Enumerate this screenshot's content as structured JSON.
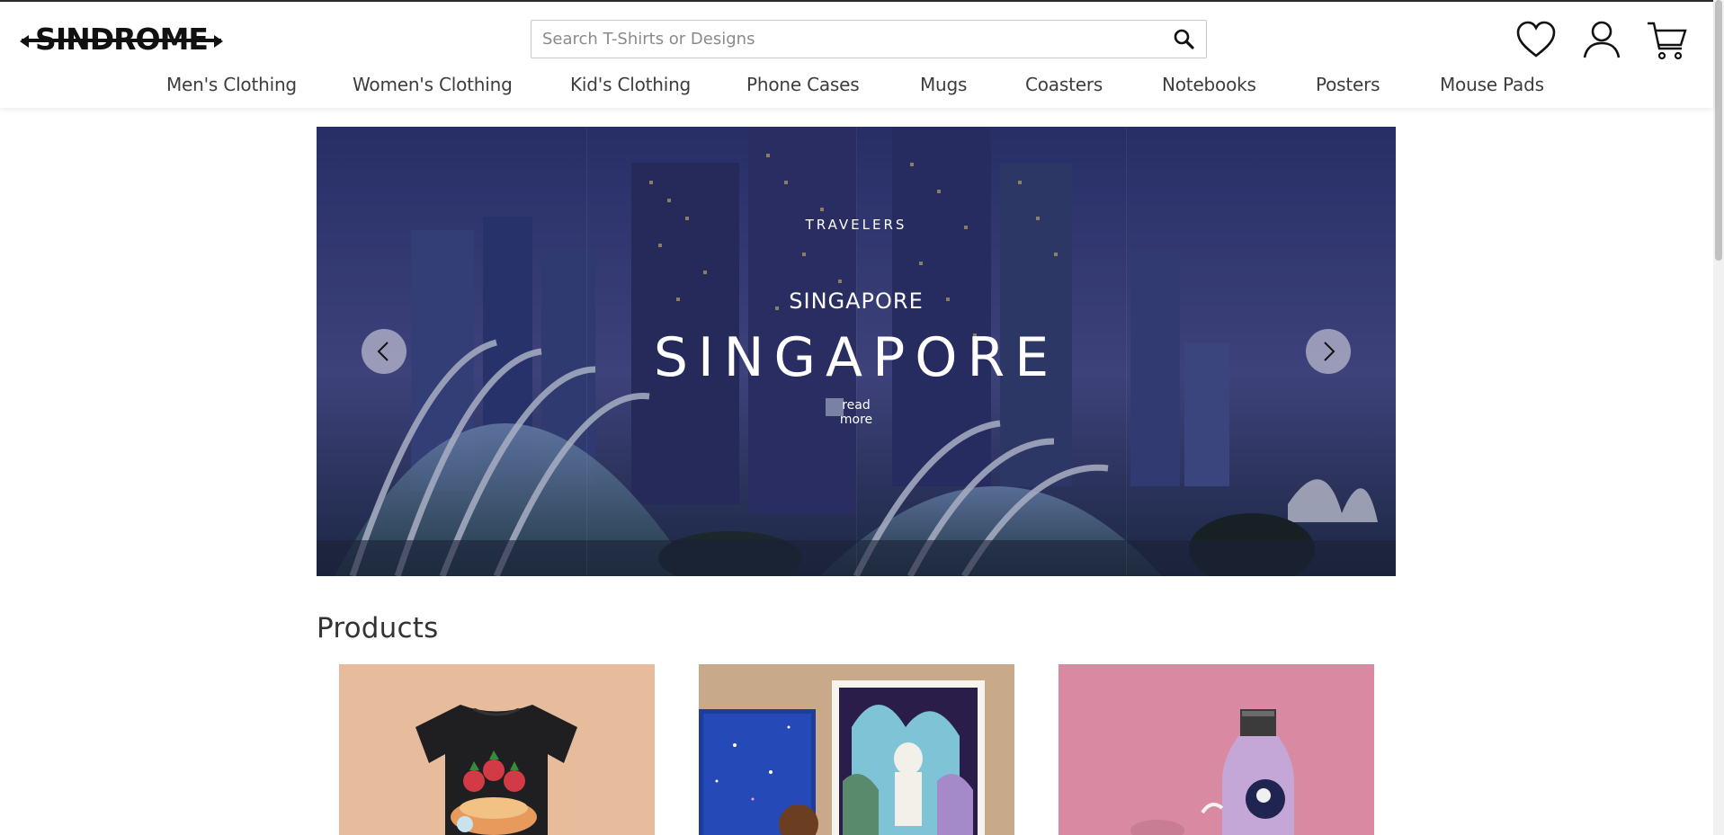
{
  "brand": {
    "logo_text": "SINDROME"
  },
  "search": {
    "placeholder": "Search T-Shirts or Designs",
    "value": ""
  },
  "header_icons": [
    "heart-icon",
    "user-icon",
    "cart-icon"
  ],
  "nav": {
    "items": [
      {
        "label": "Men's Clothing"
      },
      {
        "label": "Women's Clothing"
      },
      {
        "label": "Kid's Clothing"
      },
      {
        "label": "Phone Cases"
      },
      {
        "label": "Mugs"
      },
      {
        "label": "Coasters"
      },
      {
        "label": "Notebooks"
      },
      {
        "label": "Posters"
      },
      {
        "label": "Mouse Pads"
      }
    ]
  },
  "hero": {
    "kicker": "TRAVELERS",
    "subtitle": "SINGAPORE",
    "title": "SINGAPORE",
    "link": "read more"
  },
  "products": {
    "heading": "Products"
  },
  "colors": {
    "accent_text": "#3d3d3d",
    "hero_overlay": "#2a3370"
  }
}
